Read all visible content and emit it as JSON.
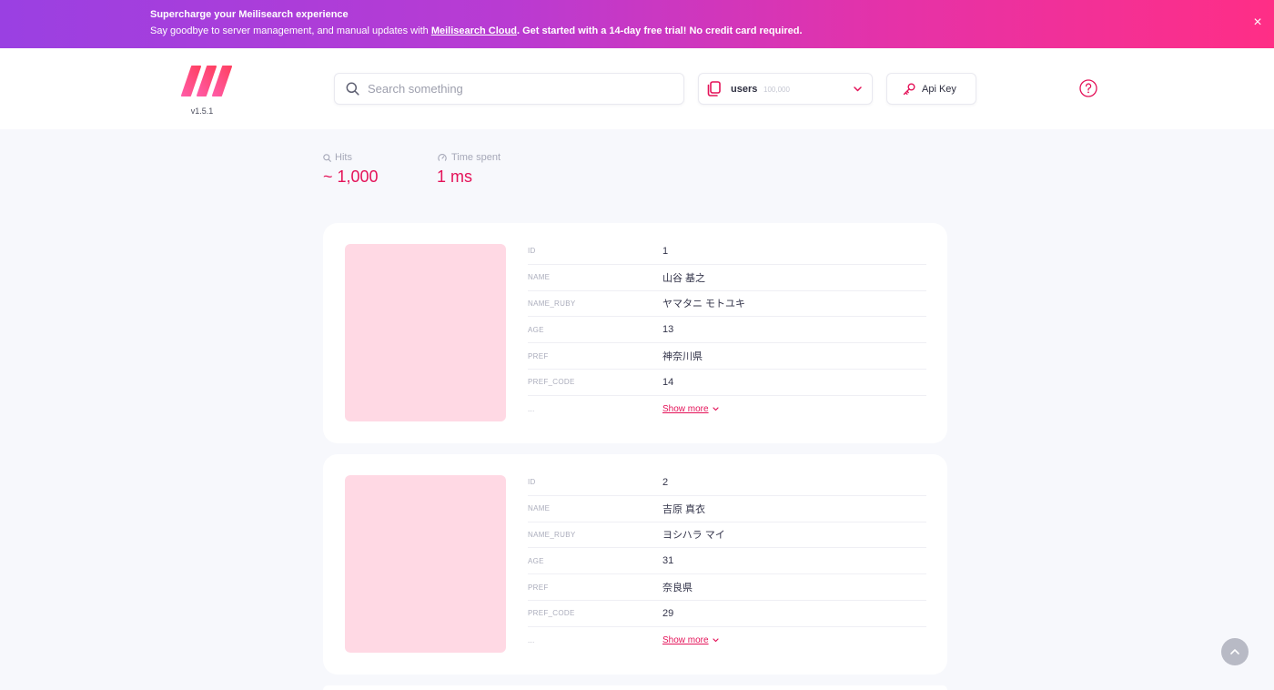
{
  "colors": {
    "brand": "#e41359",
    "banner_start": "#9a40e2",
    "banner_end": "#ff2e86",
    "page_bg": "#f7f8fc",
    "image_placeholder": "#ffd9e4"
  },
  "icons": {
    "logo": "meilisearch-logo",
    "close": "close-icon",
    "search": "search-icon",
    "index": "documents-icon",
    "index_chevron": "chevron-down-icon",
    "api_key": "key-icon",
    "help": "help-circle-icon",
    "hits": "search-icon",
    "time": "gauge-icon",
    "show_more": "chevron-down-icon",
    "scroll_top": "chevron-up-icon"
  },
  "banner": {
    "title": "Supercharge your Meilisearch experience",
    "text_before": "Say goodbye to server management, and manual updates with ",
    "link": "Meilisearch Cloud",
    "text_after": ". Get started with a 14-day free trial! No credit card required.",
    "close_label": "×"
  },
  "header": {
    "version": "v1.5.1",
    "search": {
      "placeholder": "Search something"
    },
    "index": {
      "name": "users",
      "count": "100,000"
    },
    "api_key": {
      "label": "Api Key"
    }
  },
  "stats": {
    "hits": {
      "label": "Hits",
      "value": "~ 1,000"
    },
    "time": {
      "label": "Time spent",
      "value": "1 ms"
    }
  },
  "results": [
    {
      "fields": [
        {
          "key": "ID",
          "value": "1"
        },
        {
          "key": "NAME",
          "value": "山谷 基之"
        },
        {
          "key": "NAME_RUBY",
          "value": "ヤマタニ モトユキ"
        },
        {
          "key": "AGE",
          "value": "13"
        },
        {
          "key": "PREF",
          "value": "神奈川県"
        },
        {
          "key": "PREF_CODE",
          "value": "14"
        }
      ],
      "ellipsis": "...",
      "show_more": "Show more"
    },
    {
      "fields": [
        {
          "key": "ID",
          "value": "2"
        },
        {
          "key": "NAME",
          "value": "吉原 真衣"
        },
        {
          "key": "NAME_RUBY",
          "value": "ヨシハラ マイ"
        },
        {
          "key": "AGE",
          "value": "31"
        },
        {
          "key": "PREF",
          "value": "奈良県"
        },
        {
          "key": "PREF_CODE",
          "value": "29"
        }
      ],
      "ellipsis": "...",
      "show_more": "Show more"
    }
  ]
}
